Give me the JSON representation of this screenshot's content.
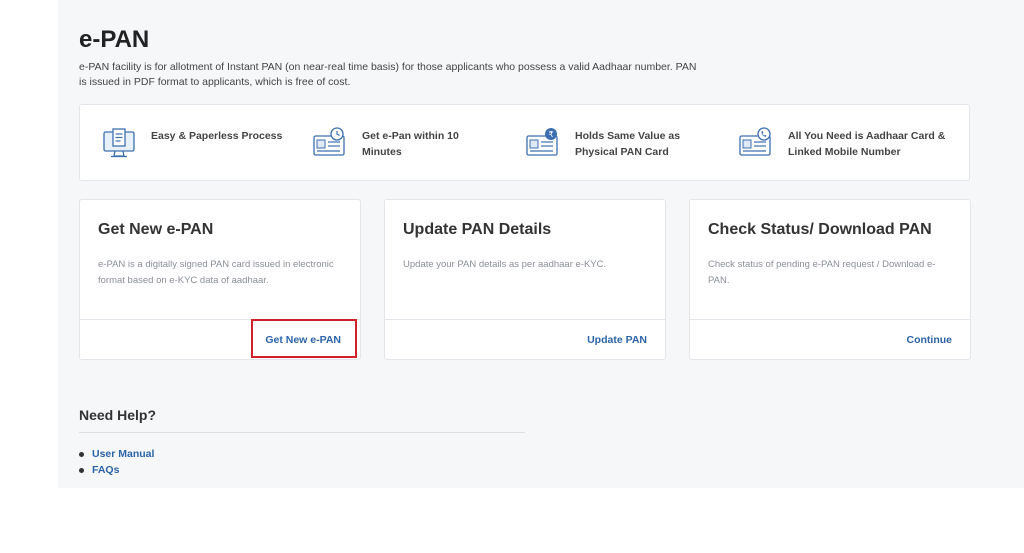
{
  "header": {
    "title": "e-PAN",
    "description": "e-PAN facility is for allotment of Instant PAN (on near-real time basis) for those applicants who possess a valid Aadhaar number. PAN is issued in PDF format to applicants, which is free of cost."
  },
  "features": [
    {
      "icon": "computer-document-icon",
      "line1": "Easy & Paperless Process",
      "line2": ""
    },
    {
      "icon": "id-card-clock-icon",
      "line1": "Get e-Pan within 10",
      "line2": "Minutes"
    },
    {
      "icon": "id-card-rupee-icon",
      "line1": "Holds Same Value as",
      "line2": "Physical PAN Card"
    },
    {
      "icon": "id-card-phone-icon",
      "line1": "All You Need is Aadhaar Card &",
      "line2": "Linked Mobile Number"
    }
  ],
  "cards": [
    {
      "title": "Get New e-PAN",
      "description": "e-PAN is a digitally signed PAN card issued in electronic format based on e-KYC data of aadhaar.",
      "action": "Get New e-PAN"
    },
    {
      "title": "Update PAN Details",
      "description": "Update your PAN details as per aadhaar e-KYC.",
      "action": "Update PAN"
    },
    {
      "title": "Check Status/ Download PAN",
      "description": "Check status of pending e-PAN request / Download e-PAN.",
      "action": "Continue"
    }
  ],
  "help": {
    "title": "Need Help?",
    "links": [
      "User Manual",
      "FAQs"
    ]
  },
  "colors": {
    "link": "#2c64a8",
    "highlight": "#d0202a"
  }
}
